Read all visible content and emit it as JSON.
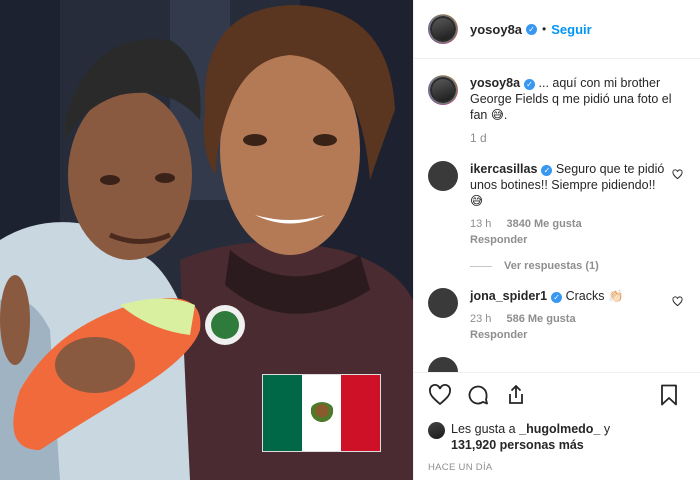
{
  "post": {
    "username": "yosoy8a",
    "follow_label": "Seguir",
    "dot": "•"
  },
  "caption": {
    "username": "yosoy8a",
    "text": "... aquí con mi brother George Fields q me pidió una foto el fan 😅.",
    "time": "1 d"
  },
  "comments": [
    {
      "username": "ikercasillas",
      "text": "Seguro que te pidió unos botines!! Siempre pidiendo!! 😅",
      "time": "13 h",
      "likes": "3840 Me gusta",
      "reply": "Responder",
      "view_replies": "Ver respuestas (1)"
    },
    {
      "username": "jona_spider1",
      "text": "Cracks 👏🏻",
      "time": "23 h",
      "likes": "586 Me gusta",
      "reply": "Responder"
    }
  ],
  "likes": {
    "prefix": "Les gusta a",
    "user": "_hugolmedo_",
    "suffix": "y",
    "count": "131,920 personas más"
  },
  "timestamp": "HACE UN DÍA",
  "icons": {
    "verified": "verified-badge-icon",
    "heart": "heart-icon",
    "comment": "comment-icon",
    "share": "share-icon",
    "save": "bookmark-icon"
  },
  "colors": {
    "follow": "#0095f6",
    "verified": "#3897f0",
    "flag_green": "#006847",
    "flag_red": "#ce1126"
  }
}
